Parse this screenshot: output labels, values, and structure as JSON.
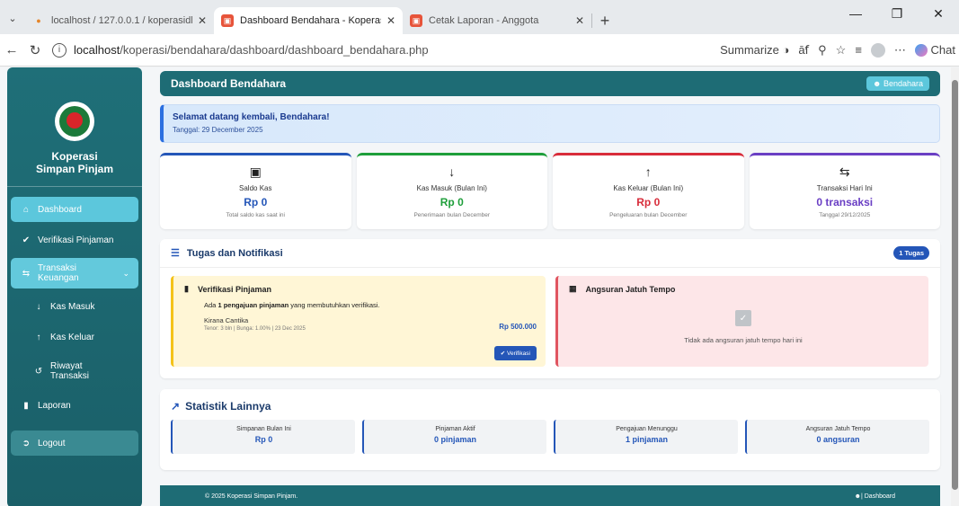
{
  "browser": {
    "tabs": [
      {
        "title": "localhost / 127.0.0.1 / koperasidb",
        "active": false
      },
      {
        "title": "Dashboard Bendahara - Koperasi",
        "active": true
      },
      {
        "title": "Cetak Laporan - Anggota",
        "active": false
      }
    ],
    "url_host": "localhost",
    "url_path": "/koperasi/bendahara/dashboard/dashboard_bendahara.php",
    "summarize_label": "Summarize",
    "chat_label": "Chat"
  },
  "sidebar": {
    "brand_line1": "Koperasi",
    "brand_line2": "Simpan Pinjam",
    "items": [
      {
        "label": "Dashboard",
        "icon": "home-icon"
      },
      {
        "label": "Verifikasi Pinjaman",
        "icon": "check-circle-icon"
      },
      {
        "label_line1": "Transaksi",
        "label_line2": "Keuangan",
        "icon": "exchange-icon"
      },
      {
        "label": "Kas Masuk",
        "icon": "arrow-down-icon"
      },
      {
        "label": "Kas Keluar",
        "icon": "arrow-up-icon"
      },
      {
        "label_line1": "Riwayat",
        "label_line2": "Transaksi",
        "icon": "history-icon"
      },
      {
        "label": "Laporan",
        "icon": "file-icon"
      },
      {
        "label": "Logout",
        "icon": "logout-icon"
      }
    ]
  },
  "header": {
    "title": "Dashboard Bendahara",
    "role": "Bendahara"
  },
  "welcome": {
    "text_prefix": "Selamat datang kembali, ",
    "name": "Bendahara",
    "suffix": "!",
    "date": "Tanggal: 29 December 2025"
  },
  "cards": [
    {
      "label": "Saldo Kas",
      "value": "Rp 0",
      "sub": "Total saldo kas saat ini",
      "color": "#2456b8"
    },
    {
      "label": "Kas Masuk (Bulan Ini)",
      "value": "Rp 0",
      "sub": "Penerimaan bulan December",
      "color": "#1e9e3a"
    },
    {
      "label": "Kas Keluar (Bulan Ini)",
      "value": "Rp 0",
      "sub": "Pengeluaran bulan December",
      "color": "#d82c3a"
    },
    {
      "label": "Transaksi Hari Ini",
      "value": "0 transaksi",
      "sub": "Tanggal 29/12/2025",
      "color": "#6a3fc4"
    }
  ],
  "tasks": {
    "title": "Tugas dan Notifikasi",
    "count_badge": "1 Tugas",
    "verif": {
      "title": "Verifikasi Pinjaman",
      "line_pre": "Ada ",
      "line_bold": "1 pengajuan pinjaman",
      "line_post": " yang membutuhkan verifikasi.",
      "name": "Kirana Cantika",
      "meta": "Tenor: 3 bln | Bunga: 1.00% | 23 Dec 2025",
      "amount": "Rp 500.000",
      "button": "Verifikasi"
    },
    "due": {
      "title": "Angsuran Jatuh Tempo",
      "empty": "Tidak ada angsuran jatuh tempo hari ini"
    }
  },
  "stats": {
    "title": "Statistik Lainnya",
    "items": [
      {
        "label": "Simpanan Bulan Ini",
        "value": "Rp 0"
      },
      {
        "label": "Pinjaman Aktif",
        "value": "0 pinjaman"
      },
      {
        "label": "Pengajuan Menunggu",
        "value": "1 pinjaman"
      },
      {
        "label": "Angsuran Jatuh Tempo",
        "value": "0 angsuran"
      }
    ]
  },
  "footer": {
    "copyright": "© 2025 Koperasi Simpan Pinjam.",
    "right": "| Dashboard"
  }
}
